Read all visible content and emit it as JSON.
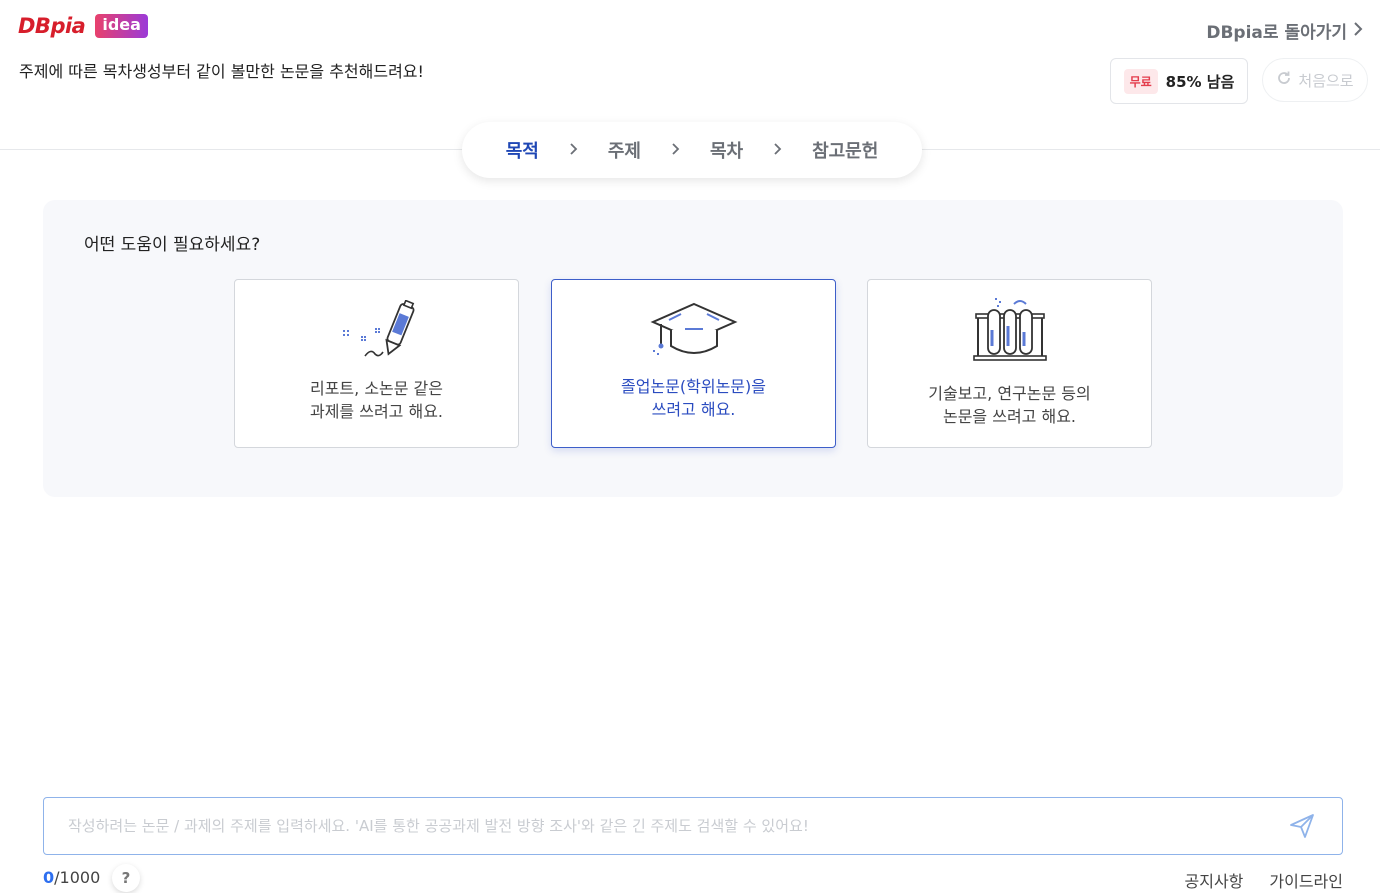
{
  "header": {
    "logo_text": "DBpia",
    "logo_badge": "idea",
    "tagline": "주제에 따른 목차생성부터 같이 볼만한 논문을 추천해드려요!",
    "back_link": "DBpia로 돌아가기",
    "quota_badge": "무료",
    "quota_text": "85% 남음",
    "restart_label": "처음으로"
  },
  "steps": [
    {
      "label": "목적",
      "active": true
    },
    {
      "label": "주제",
      "active": false
    },
    {
      "label": "목차",
      "active": false
    },
    {
      "label": "참고문헌",
      "active": false
    }
  ],
  "panel": {
    "question": "어떤 도움이 필요하세요?",
    "options": [
      {
        "line1": "리포트, 소논문 같은",
        "line2": "과제를 쓰려고 해요.",
        "icon": "pen-icon",
        "selected": false
      },
      {
        "line1": "졸업논문(학위논문)을",
        "line2": "쓰려고 해요.",
        "icon": "graduation-cap-icon",
        "selected": true
      },
      {
        "line1": "기술보고, 연구논문 등의",
        "line2": "논문을 쓰려고 해요.",
        "icon": "test-tubes-icon",
        "selected": false
      }
    ]
  },
  "input": {
    "placeholder": "작성하려는 논문 / 과제의 주제를 입력하세요. 'AI를 통한 공공과제 발전 방향 조사'와 같은 긴 주제도 검색할 수 있어요!",
    "value": "",
    "count": "0",
    "max": "/1000"
  },
  "footer": {
    "help": "?",
    "notice": "공지사항",
    "guideline": "가이드라인"
  },
  "colors": {
    "brand_red": "#d71e2b",
    "accent_blue": "#1f47b5",
    "selected_border": "#3d5ec9",
    "count_blue": "#2d6ff0"
  }
}
